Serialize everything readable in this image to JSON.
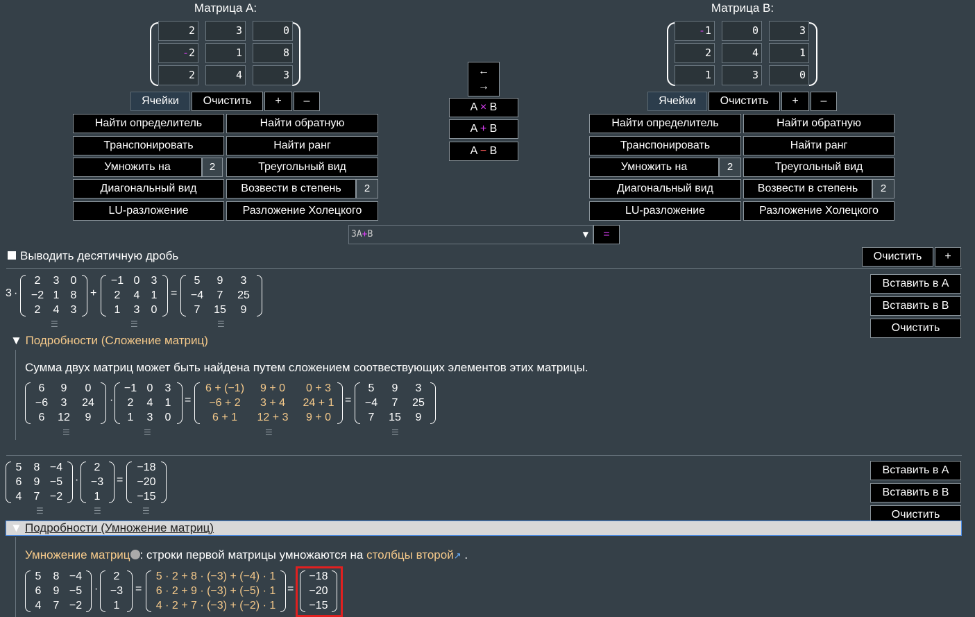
{
  "matA": {
    "title": "Матрица A:",
    "cells": [
      "2",
      "3",
      "0",
      "-2",
      "1",
      "8",
      "2",
      "4",
      "3"
    ]
  },
  "matB": {
    "title": "Матрица B:",
    "cells": [
      "-1",
      "0",
      "3",
      "2",
      "4",
      "1",
      "1",
      "3",
      "0"
    ]
  },
  "ctrl": {
    "cells": "Ячейки",
    "clear": "Очистить",
    "plus": "+",
    "minus": "–"
  },
  "ops": {
    "det": "Найти определитель",
    "inv": "Найти обратную",
    "tr": "Транспонировать",
    "rank": "Найти ранг",
    "mul": "Умножить на",
    "mul_val": "2",
    "tri": "Треугольный вид",
    "diag": "Диагональный вид",
    "pow": "Возвести в степень",
    "pow_val": "2",
    "lu": "LU-разложение",
    "chol": "Разложение Холецкого"
  },
  "center": {
    "swap_l": "←",
    "swap_r": "→",
    "axb": [
      "A ",
      "×",
      " B"
    ],
    "apb": [
      "A ",
      "+",
      " B"
    ],
    "amb": [
      "A ",
      "−",
      " B"
    ]
  },
  "expr": {
    "value_pre": "3A",
    "value_op": "+",
    "value_post": "B",
    "arrow": "▼",
    "eq": "="
  },
  "decimal": "Выводить десятичную дробь",
  "topright": {
    "clear": "Очистить",
    "plus": "+"
  },
  "r1": {
    "coef": "3",
    "dot": "·",
    "plus": "+",
    "eq": "=",
    "a": [
      "2",
      "3",
      "0",
      "−2",
      "1",
      "8",
      "2",
      "4",
      "3"
    ],
    "b": [
      "−1",
      "0",
      "3",
      "2",
      "4",
      "1",
      "1",
      "3",
      "0"
    ],
    "c": [
      "5",
      "9",
      "3",
      "−4",
      "7",
      "25",
      "7",
      "15",
      "9"
    ],
    "insA": "Вставить в A",
    "insB": "Вставить в B",
    "clr": "Очистить",
    "ham": "☰",
    "details": "Подробности (Сложение матриц)",
    "desc": "Сумма двух матриц может быть найдена путем сложением соотвествующих элементов этих матрицы.",
    "d1": [
      "6",
      "9",
      "0",
      "−6",
      "3",
      "24",
      "6",
      "12",
      "9"
    ],
    "d2": [
      "−1",
      "0",
      "3",
      "2",
      "4",
      "1",
      "1",
      "3",
      "0"
    ],
    "d3": [
      "6 + (−1)",
      "9 + 0",
      "0 + 3",
      "−6 + 2",
      "3 + 4",
      "24 + 1",
      "6 + 1",
      "12 + 3",
      "9 + 0"
    ],
    "d4": [
      "5",
      "9",
      "3",
      "−4",
      "7",
      "25",
      "7",
      "15",
      "9"
    ]
  },
  "r2": {
    "dot": "·",
    "eq": "=",
    "a": [
      "5",
      "8",
      "−4",
      "6",
      "9",
      "−5",
      "4",
      "7",
      "−2"
    ],
    "b": [
      "2",
      "−3",
      "1"
    ],
    "c": [
      "−18",
      "−20",
      "−15"
    ],
    "insA": "Вставить в A",
    "insB": "Вставить в B",
    "clr": "Очистить",
    "ham": "☰",
    "details": "Подробности (Умножение матриц)",
    "desc_link1": "Умножение матриц",
    "desc_mid": ": строки первой матрицы умножаются на ",
    "desc_link2": "столбцы второй",
    "desc_end": " .",
    "d3": [
      "5 · 2 + 8 · (−3) + (−4) · 1",
      "6 · 2 + 9 · (−3) + (−5) · 1",
      "4 · 2 + 7 · (−3) + (−2) · 1"
    ]
  }
}
